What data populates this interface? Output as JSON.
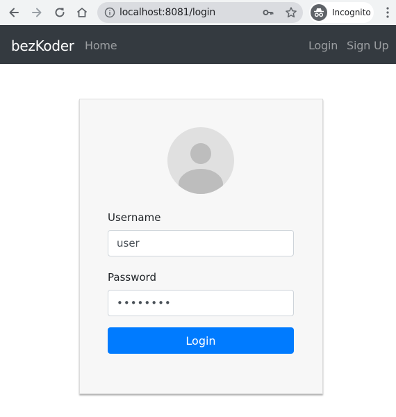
{
  "browser": {
    "url": "localhost:8081/login",
    "incognito_label": "Incognito"
  },
  "navbar": {
    "brand": "bezKoder",
    "home": "Home",
    "login": "Login",
    "signup": "Sign Up",
    "bg_color": "#343a40"
  },
  "form": {
    "username_label": "Username",
    "username_value": "user",
    "password_label": "Password",
    "password_value": "••••••••",
    "submit_label": "Login",
    "accent_color": "#007bff"
  },
  "icons": {
    "back": "arrow-left-icon",
    "forward": "arrow-right-icon",
    "reload": "reload-icon",
    "home": "home-icon",
    "info": "info-icon",
    "key": "key-icon",
    "star": "star-icon",
    "incognito": "incognito-icon",
    "menu": "kebab-menu-icon",
    "avatar": "user-avatar-icon"
  }
}
